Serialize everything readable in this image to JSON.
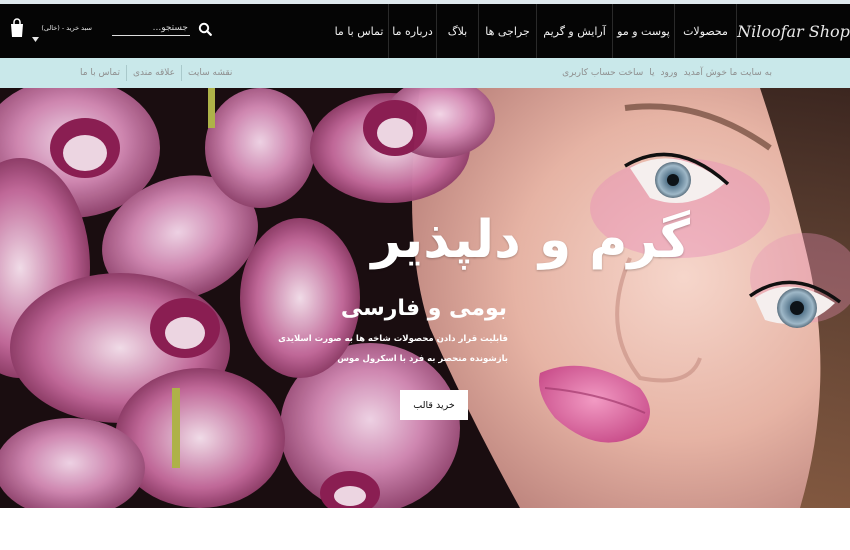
{
  "header": {
    "brand": "Niloofar Shop",
    "menu": [
      {
        "label": "محصولات",
        "width": 62
      },
      {
        "label": "پوست و مو",
        "width": 62
      },
      {
        "label": "آرایش و گریم",
        "width": 76
      },
      {
        "label": "جراجی ها",
        "width": 58
      },
      {
        "label": "بلاگ",
        "width": 42
      },
      {
        "label": "درباره ما",
        "width": 48
      },
      {
        "label": "تماس با ما",
        "width": 58
      }
    ],
    "search_placeholder": "جستجو...",
    "cart_label": "سبد خرید - (خالی)"
  },
  "subbar": {
    "welcome": "به سایت ما خوش آمدید",
    "login": "ورود",
    "or": "یا",
    "register": "ساخت حساب کاربری",
    "links": [
      "نقشه سایت",
      "علاقه مندی",
      "تماس با ما"
    ]
  },
  "hero": {
    "title": "گرم و دلپذیر",
    "subtitle": "بومی و فارسی",
    "desc_line1": "قابلیت قرار دادن محصولات شاخه ها به صورت اسلایدی",
    "desc_line2": "بازشونده منحصر به فرد با اسکرول موس",
    "button": "خرید قالب"
  },
  "icons": {
    "search": "search-icon",
    "cart": "shopping-bag-icon",
    "dropdown": "chevron-down-icon"
  },
  "colors": {
    "nav_bg": "#050505",
    "subbar_bg": "#c9e8ea",
    "orchid": "#c24a86",
    "skin": "#e8b9a8"
  }
}
